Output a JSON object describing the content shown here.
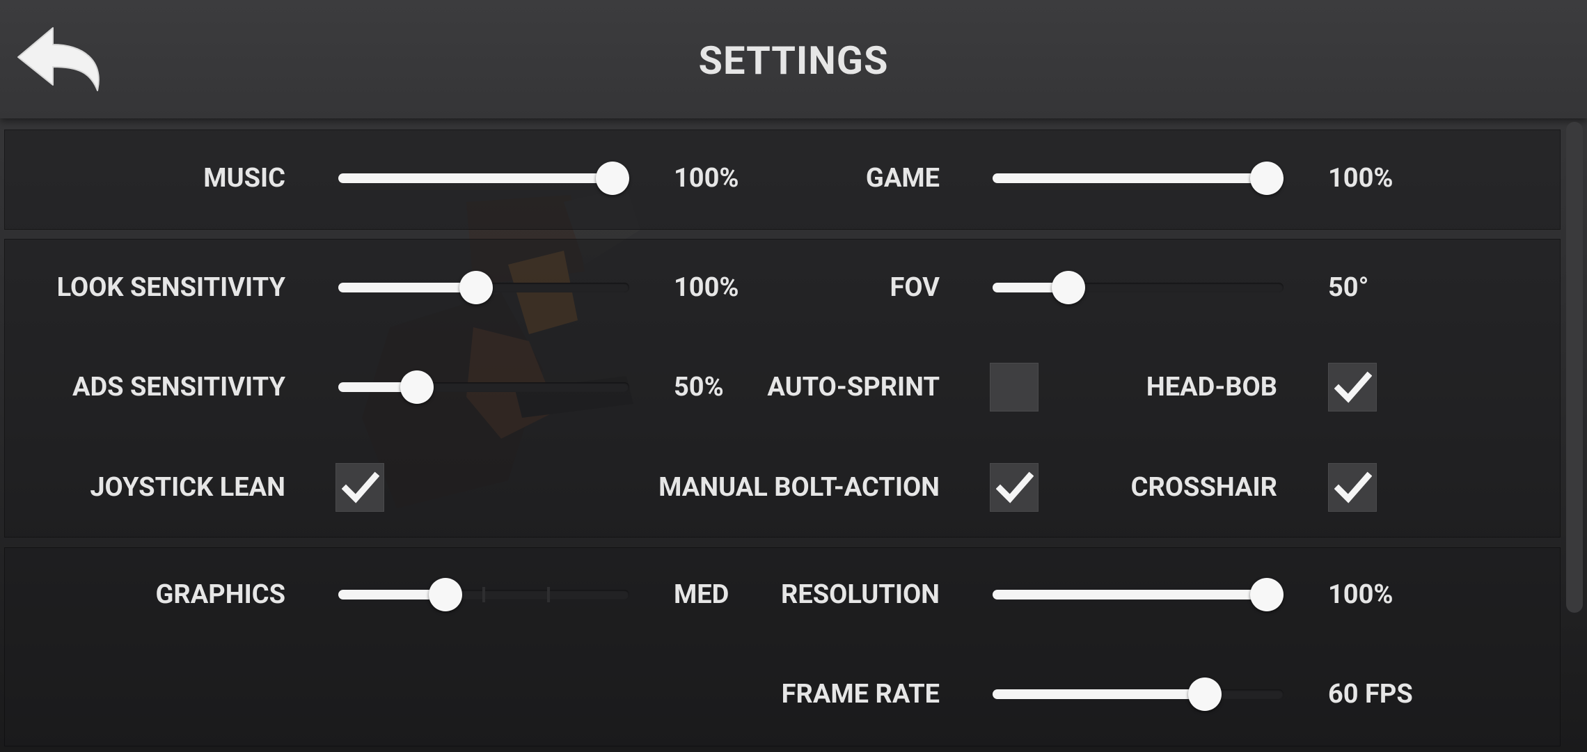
{
  "header": {
    "title": "SETTINGS",
    "back_icon": "back-arrow-icon"
  },
  "audio": {
    "music": {
      "label": "MUSIC",
      "value": 1.0,
      "value_text": "100%"
    },
    "game": {
      "label": "GAME",
      "value": 1.0,
      "value_text": "100%"
    }
  },
  "controls": {
    "look_sensitivity": {
      "label": "LOOK SENSITIVITY",
      "value": 0.47,
      "value_text": "100%"
    },
    "fov": {
      "label": "FOV",
      "value": 0.23,
      "value_text": "50°"
    },
    "ads_sensitivity": {
      "label": "ADS SENSITIVITY",
      "value": 0.24,
      "value_text": "50%"
    },
    "auto_sprint": {
      "label": "AUTO-SPRINT",
      "checked": false
    },
    "head_bob": {
      "label": "HEAD-BOB",
      "checked": true
    },
    "joystick_lean": {
      "label": "JOYSTICK LEAN",
      "checked": true
    },
    "manual_bolt_action": {
      "label": "MANUAL BOLT-ACTION",
      "checked": true
    },
    "crosshair": {
      "label": "CROSSHAIR",
      "checked": true
    }
  },
  "video": {
    "graphics": {
      "label": "GRAPHICS",
      "value": 0.35,
      "value_text": "MED",
      "steps": 4
    },
    "resolution": {
      "label": "RESOLUTION",
      "value": 1.0,
      "value_text": "100%"
    },
    "frame_rate": {
      "label": "FRAME RATE",
      "value": 0.76,
      "value_text": "60 FPS",
      "steps": 5
    }
  },
  "colors": {
    "accent": "#f5f5f5",
    "track": "#222224",
    "panel": "#1c1c1e"
  }
}
